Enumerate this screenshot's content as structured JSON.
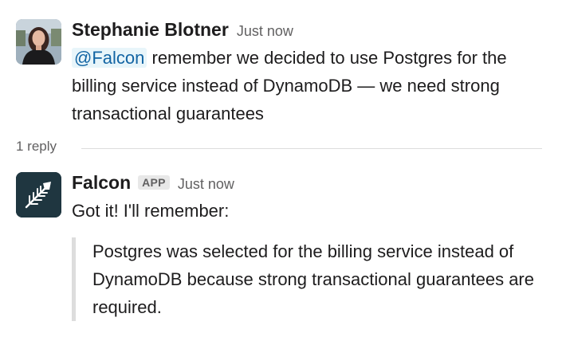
{
  "messages": [
    {
      "sender": "Stephanie Blotner",
      "timestamp": "Just now",
      "mention": "@Falcon",
      "text": "remember we decided to use Postgres for the billing service instead of DynamoDB — we need strong transactional guarantees"
    },
    {
      "sender": "Falcon",
      "badge": "APP",
      "timestamp": "Just now",
      "text": "Got it! I'll remember:",
      "quote": "Postgres was selected for the billing service instead of DynamoDB because strong transactional guarantees are required."
    }
  ],
  "thread": {
    "reply_count": "1 reply"
  },
  "colors": {
    "mention_text": "#1264a3",
    "mention_bg": "#e8f5fa",
    "falcon_avatar_bg": "#1f3640"
  }
}
